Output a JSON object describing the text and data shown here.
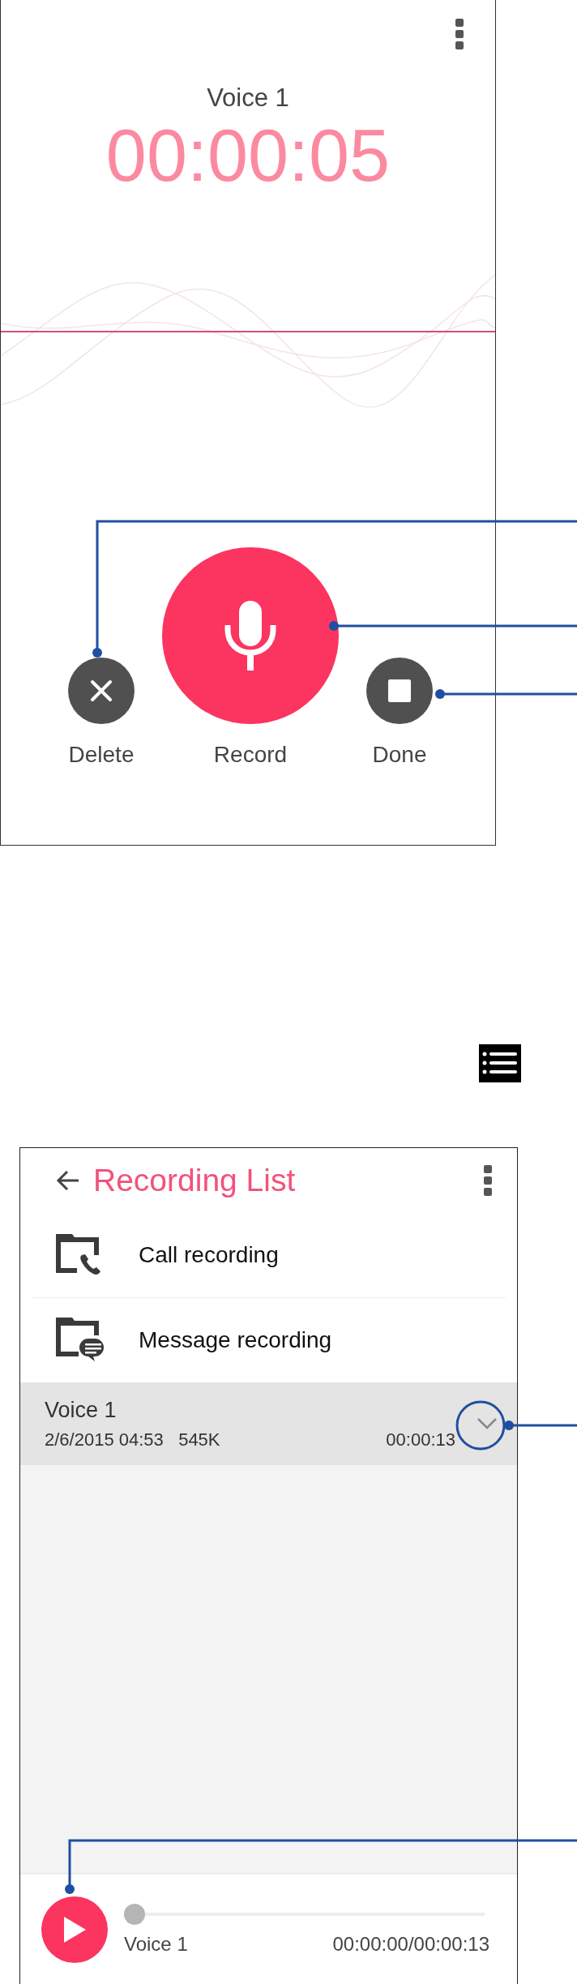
{
  "recorder": {
    "title": "Voice 1",
    "elapsed": "00:00:05",
    "controls": [
      {
        "kind": "delete",
        "label": "Delete"
      },
      {
        "kind": "record",
        "label": "Record"
      },
      {
        "kind": "done",
        "label": "Done"
      }
    ]
  },
  "recording_list": {
    "title": "Recording List",
    "folders": [
      {
        "kind": "call",
        "label": "Call recording"
      },
      {
        "kind": "message",
        "label": "Message recording"
      }
    ],
    "recordings": [
      {
        "name": "Voice 1",
        "date": "2/6/2015 04:53",
        "size": "545K",
        "duration": "00:00:13",
        "selected": true
      }
    ],
    "player": {
      "name": "Voice 1",
      "time": "00:00:00/00:00:13",
      "level": 0
    }
  }
}
